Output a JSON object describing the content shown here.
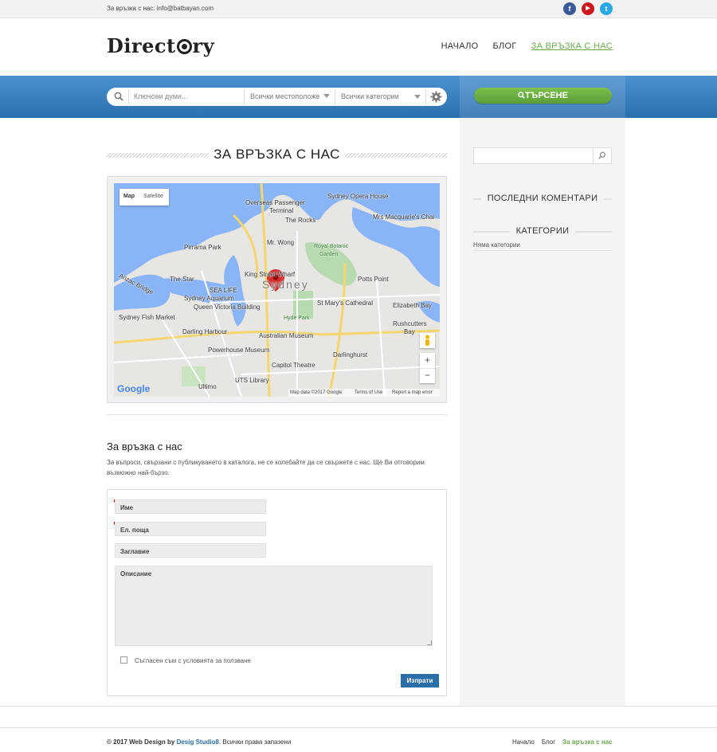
{
  "topbar": {
    "contact": "За връзка с нас: info@batbayan.com",
    "social": [
      {
        "name": "facebook-icon",
        "glyph": "f",
        "color": "#3b5998"
      },
      {
        "name": "youtube-icon",
        "glyph": "▶",
        "color": "#cc181e"
      },
      {
        "name": "twitter-icon",
        "glyph": "t",
        "color": "#29a9e1"
      }
    ]
  },
  "header": {
    "logo_before": "Direct",
    "logo_after": "ry",
    "nav": [
      "НАЧАЛО",
      "БЛОГ",
      "ЗА ВРЪЗКА С НАС"
    ]
  },
  "search": {
    "keywords_placeholder": "Ключови думи...",
    "location_value": "Всички местоположе",
    "category_value": "Всички категории",
    "button_label": "ТЪРСЕНЕ"
  },
  "page": {
    "title": "ЗА ВРЪЗКА С НАС"
  },
  "map": {
    "type_map": "Map",
    "type_satellite": "Satellite",
    "city": "Sydney",
    "google": "Google",
    "footer_data": "Map data ©2017 Google",
    "footer_terms": "Terms of Use",
    "footer_report": "Report a map error",
    "zoom_in": "+",
    "zoom_out": "−",
    "labels": {
      "opera": "Sydney Opera House",
      "overseas": "Overseas Passenger",
      "terminal": "Terminal",
      "rocks": "The Rocks",
      "macquarie": "Mrs Macquarie's Chai",
      "pirrama": "Pirrama Park",
      "wong": "Mr. Wong",
      "botanic1": "Royal Botanic",
      "botanic2": "Garden",
      "star": "The Star",
      "anzac": "Anzac Bridge",
      "wharf": "King Street Wharf",
      "sealife": "SEA LIFE",
      "aquarium": "Sydney Aquarium",
      "qvb": "Queen Victoria Building",
      "potts": "Potts Point",
      "cathedral": "St Mary's Cathedral",
      "elizabeth": "Elizabeth Bay",
      "fish": "Sydney Fish Market",
      "darling": "Darling Harbour",
      "hyde": "Hyde Park",
      "rushcutters": "Rushcutters",
      "bay": "Bay",
      "museum": "Australian Museum",
      "powerhouse": "Powerhouse Museum",
      "darlinghurst": "Darlinghurst",
      "capitol": "Capitol Theatre",
      "ultimo": "Ultimo",
      "uts": "UTS Library"
    }
  },
  "contact": {
    "title": "За връзка с нас",
    "text": "За въпроси, свързани с публикуването в каталога, не се колебайте да се свържете с нас. Ще Ви отговорим възможно най-бързо."
  },
  "form": {
    "name_placeholder": "Име",
    "email_placeholder": "Ел. поща",
    "subject_placeholder": "Заглавие",
    "description_placeholder": "Описание",
    "agree_label": "Съгласен съм с условията за ползване",
    "send_label": "Изпрати"
  },
  "sidebar": {
    "recent_comments": "ПОСЛЕДНИ КОМЕНТАРИ",
    "categories": "КАТЕГОРИИ",
    "no_categories": "Няма категории"
  },
  "footer": {
    "copyright": "© 2017 Web Design by",
    "studio": "Desig Studio8",
    "rights": ". Всички права запазени",
    "nav": [
      "Начало",
      "Блог",
      "За връзка с нас"
    ]
  },
  "colors": {
    "accent_green": "#6aa84f",
    "band_blue": "#2a6fae",
    "button_blue": "#2c6ea8"
  }
}
